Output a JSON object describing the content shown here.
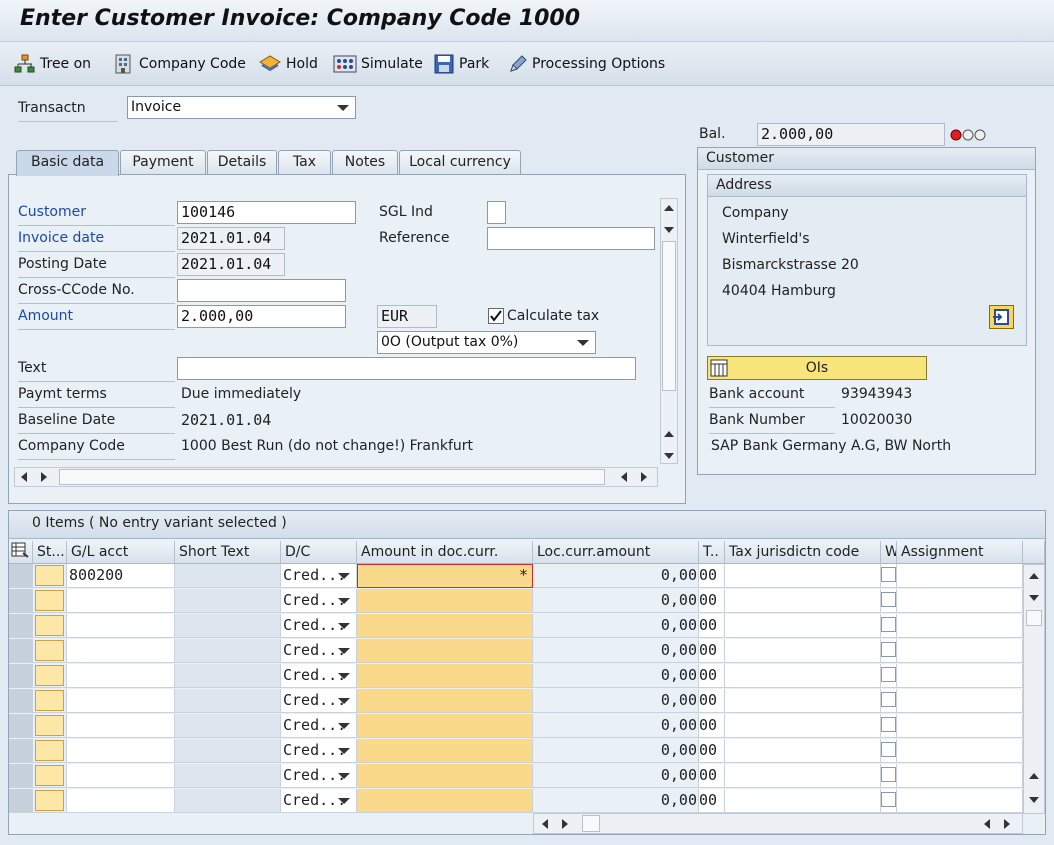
{
  "title": "Enter Customer Invoice: Company Code 1000",
  "toolbar": {
    "tree_on": "Tree on",
    "company_code": "Company Code",
    "hold": "Hold",
    "simulate": "Simulate",
    "park": "Park",
    "processing_options": "Processing Options"
  },
  "transaction": {
    "label": "Transactn",
    "value": "Invoice"
  },
  "balance": {
    "label": "Bal.",
    "value": "2.000,00",
    "status_color": "#e02020"
  },
  "tabs": [
    "Basic data",
    "Payment",
    "Details",
    "Tax",
    "Notes",
    "Local currency"
  ],
  "basic": {
    "customer_label": "Customer",
    "customer_value": "100146",
    "sgl_label": "SGL Ind",
    "sgl_value": "",
    "invoice_date_label": "Invoice date",
    "invoice_date_value": "2021.01.04",
    "reference_label": "Reference",
    "reference_value": "",
    "posting_date_label": "Posting Date",
    "posting_date_value": "2021.01.04",
    "cross_ccode_label": "Cross-CCode No.",
    "cross_ccode_value": "",
    "amount_label": "Amount",
    "amount_value": "2.000,00",
    "currency": "EUR",
    "calc_tax_label": "Calculate tax",
    "calc_tax_checked": true,
    "tax_code": "0O (Output tax 0%)",
    "text_label": "Text",
    "text_value": "",
    "paymt_terms_label": "Paymt terms",
    "paymt_terms_value": "Due immediately",
    "baseline_label": "Baseline Date",
    "baseline_value": "2021.01.04",
    "company_code_label": "Company Code",
    "company_code_value": "1000 Best Run (do not change!) Frankfurt"
  },
  "customer_panel": {
    "header": "Customer",
    "address_header": "Address",
    "address_lines": [
      "Company",
      "Winterfield's",
      "Bismarckstrasse 20",
      "40404 Hamburg"
    ],
    "ois_label": "OIs",
    "bank_account_label": "Bank account",
    "bank_account_value": "93943943",
    "bank_number_label": "Bank Number",
    "bank_number_value": "10020030",
    "bank_name": "SAP Bank Germany A.G, BW North"
  },
  "items": {
    "summary": "0 Items ( No entry variant selected )",
    "columns": [
      "St...",
      "G/L acct",
      "Short Text",
      "D/C",
      "Amount in doc.curr.",
      "Loc.curr.amount",
      "T..",
      "Tax jurisdictn code",
      "W",
      "Assignment"
    ],
    "rows": [
      {
        "gl": "800200",
        "dc": "Cred...",
        "amount": "*",
        "loc": "0,00",
        "tax": "00"
      },
      {
        "gl": "",
        "dc": "Cred...",
        "amount": "",
        "loc": "0,00",
        "tax": "00"
      },
      {
        "gl": "",
        "dc": "Cred...",
        "amount": "",
        "loc": "0,00",
        "tax": "00"
      },
      {
        "gl": "",
        "dc": "Cred...",
        "amount": "",
        "loc": "0,00",
        "tax": "00"
      },
      {
        "gl": "",
        "dc": "Cred...",
        "amount": "",
        "loc": "0,00",
        "tax": "00"
      },
      {
        "gl": "",
        "dc": "Cred...",
        "amount": "",
        "loc": "0,00",
        "tax": "00"
      },
      {
        "gl": "",
        "dc": "Cred...",
        "amount": "",
        "loc": "0,00",
        "tax": "00"
      },
      {
        "gl": "",
        "dc": "Cred...",
        "amount": "",
        "loc": "0,00",
        "tax": "00"
      },
      {
        "gl": "",
        "dc": "Cred...",
        "amount": "",
        "loc": "0,00",
        "tax": "00"
      },
      {
        "gl": "",
        "dc": "Cred...",
        "amount": "",
        "loc": "0,00",
        "tax": "00"
      }
    ]
  },
  "colors": {
    "amount_col": "#fbd98a",
    "status_cell": "#fde7a6",
    "ois_button": "#f7e47a"
  }
}
